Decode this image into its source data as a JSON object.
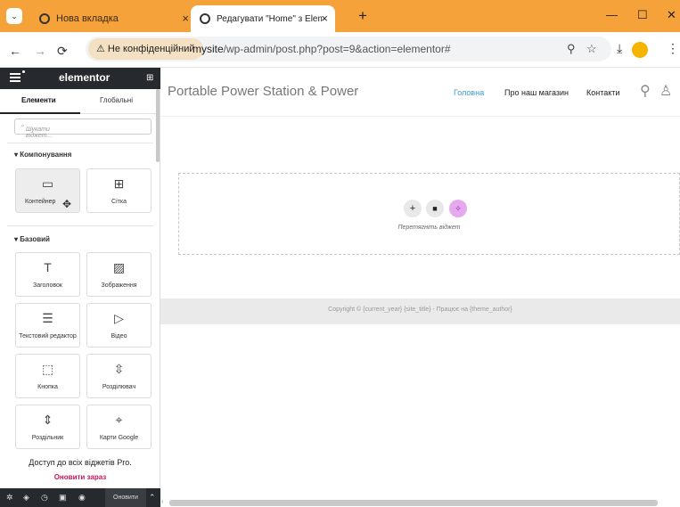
{
  "browser": {
    "tabs": [
      {
        "label": "Нова вкладка",
        "close": "×"
      },
      {
        "label": "Редагувати \"Home\" з Elemento",
        "close": "×"
      }
    ],
    "new_tab": "+",
    "window_controls": {
      "minimize": "—",
      "maximize": "☐",
      "close": "✕"
    },
    "security_label": "Не конфіденційний",
    "url_host": "mysite",
    "url_path": "/wp-admin/post.php?post=9&action=elementor#"
  },
  "panel": {
    "logo": "elementor",
    "tabs": [
      "Елементи",
      "Глобальні"
    ],
    "search_placeholder": "Шукати віджет...",
    "sections": [
      {
        "title": "Компонування",
        "widgets": [
          {
            "label": "Контейнер",
            "icon": "container-icon"
          },
          {
            "label": "Сітка",
            "icon": "grid-icon"
          }
        ]
      },
      {
        "title": "Базовий",
        "widgets": [
          {
            "label": "Заголовок",
            "icon": "heading-icon"
          },
          {
            "label": "Зображення",
            "icon": "image-icon"
          },
          {
            "label": "Текстовий редактор",
            "icon": "text-editor-icon"
          },
          {
            "label": "Відео",
            "icon": "video-icon"
          },
          {
            "label": "Кнопка",
            "icon": "button-icon"
          },
          {
            "label": "Розділювач",
            "icon": "divider-icon"
          },
          {
            "label": "Роздільник",
            "icon": "spacer-icon"
          },
          {
            "label": "Карти Google",
            "icon": "google-maps-icon"
          }
        ]
      }
    ],
    "promo_text": "Доступ до всіх віджетів Pro.",
    "promo_link": "Оновити зараз",
    "footer_update": "Оновити"
  },
  "site": {
    "title": "Portable Power Station & Power",
    "nav": [
      "Головна",
      "Про наш магазин",
      "Контакти"
    ],
    "drop_hint": "Перетягніть віджет",
    "footer_text": "Copyright © {current_year} {site_title} - Працює на {theme_author}"
  },
  "colors": {
    "browser_chrome": "#f5a23a",
    "panel_dark": "#26292d",
    "active_nav": "#3a9bd8",
    "promo_link": "#c2185b",
    "ai_button": "#e6a9ef"
  }
}
